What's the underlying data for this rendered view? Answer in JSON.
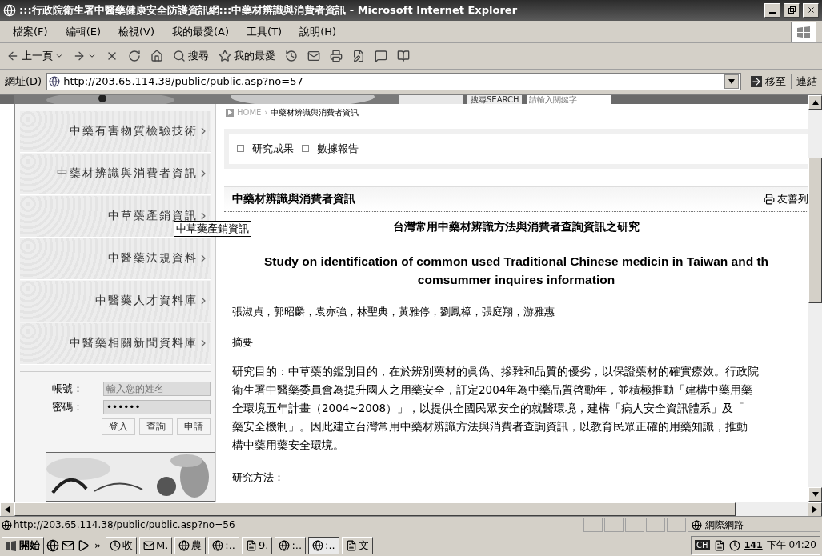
{
  "window": {
    "title": ":::行政院衛生署中醫藥健康安全防護資訊網:::中藥材辨識與消費者資訊 - Microsoft Internet Explorer"
  },
  "menu": [
    "檔案(F)",
    "編輯(E)",
    "檢視(V)",
    "我的最愛(A)",
    "工具(T)",
    "說明(H)"
  ],
  "toolbar": [
    {
      "kind": "back",
      "label": "上一頁"
    },
    {
      "kind": "forward"
    },
    {
      "kind": "stop"
    },
    {
      "kind": "refresh"
    },
    {
      "kind": "home"
    },
    {
      "kind": "search",
      "label": "搜尋"
    },
    {
      "kind": "favorites",
      "label": "我的最愛"
    },
    {
      "kind": "history"
    },
    {
      "kind": "mail"
    },
    {
      "kind": "print"
    },
    {
      "kind": "edit"
    },
    {
      "kind": "note"
    },
    {
      "kind": "research"
    }
  ],
  "address": {
    "label": "網址(D)",
    "url": "http://203.65.114.38/public/public.asp?no=57",
    "go": "移至",
    "links": "連結"
  },
  "banner": {
    "search_label": "搜尋SEARCH",
    "search_placeholder": "請輸入關鍵字"
  },
  "sidebar": {
    "items": [
      {
        "label": "中藥有害物質檢驗技術"
      },
      {
        "label": "中藥材辨識與消費者資訊"
      },
      {
        "label": "中草藥產銷資訊"
      },
      {
        "label": "中醫藥法規資料"
      },
      {
        "label": "中醫藥人才資料庫"
      },
      {
        "label": "中醫藥相關新聞資料庫"
      }
    ],
    "tooltip": "中草藥產銷資訊",
    "login": {
      "account_label": "帳號：",
      "account_placeholder": "輸入您的姓名",
      "password_label": "密碼：",
      "password_value": "••••••",
      "buttons": [
        "登入",
        "查詢",
        "申請"
      ]
    }
  },
  "breadcrumb": {
    "home": "HOME",
    "separator": "›",
    "current": "中藥材辨識與消費者資訊"
  },
  "tabs": [
    "研究成果",
    "數據報告"
  ],
  "article": {
    "section_title": "中藥材辨識與消費者資訊",
    "print_label": "友善列",
    "title_zh": "台灣常用中藥材辨識方法與消費者查詢資訊之研究",
    "title_en": [
      "Study on identification of common used Traditional Chinese medicin in Taiwan and th",
      "comsummer inquires information"
    ],
    "authors": "張淑貞，郭昭麟，袁亦強，林聖典，黃雅停，劉鳳樟，張庭翔，游雅惠",
    "abstract_heading": "摘要",
    "abstract_lines": [
      "研究目的：中草藥的鑑別目的，在於辨別藥材的眞偽、摻雜和品質的優劣，以保證藥材的確實療效。行政院",
      "衛生署中醫藥委員會為提升國人之用藥安全，訂定2004年為中藥品質啓動年，並積極推動「建構中藥用藥",
      "全環境五年計畫（2004~2008）」，以提供全國民眾安全的就醫環境，建構「病人安全資訊體系」及「",
      "藥安全機制」。因此建立台灣常用中藥材辨識方法與消費者查詢資訊，以教育民眾正確的用藥知識，推動",
      "構中藥用藥安全環境。"
    ],
    "methods_heading": "研究方法："
  },
  "status_bar": {
    "url": "http://203.65.114.38/public/public.asp?no=56",
    "zone": "網際網路"
  },
  "taskbar": {
    "start": "開始",
    "chevron": "»",
    "tasks": [
      {
        "kind": "clock",
        "label": "收",
        "selected": false
      },
      {
        "kind": "mail",
        "label": "M.",
        "selected": false
      },
      {
        "kind": "ie",
        "label": "農",
        "selected": false
      },
      {
        "kind": "ie",
        "label": ":..",
        "selected": false
      },
      {
        "kind": "doc",
        "label": "9.",
        "selected": false
      },
      {
        "kind": "ie",
        "label": ":..",
        "selected": false
      },
      {
        "kind": "ie",
        "label": ":..",
        "selected": true
      },
      {
        "kind": "doc",
        "label": "文",
        "selected": false
      }
    ],
    "language": "CH",
    "badge": "141",
    "clock": "下午 04:20"
  }
}
